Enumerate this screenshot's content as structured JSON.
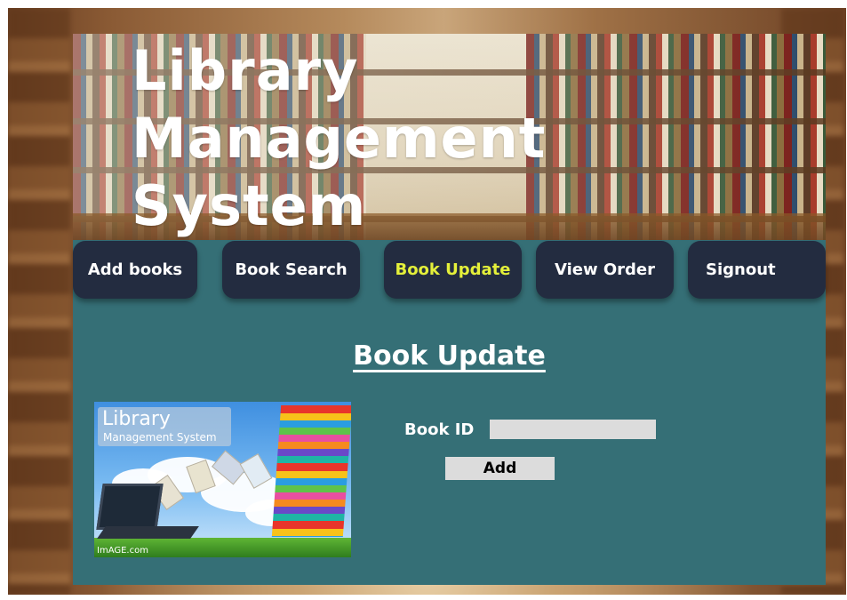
{
  "header": {
    "title_lines": [
      "Library",
      "Management",
      "System"
    ]
  },
  "nav": {
    "items": [
      {
        "label": "Add books",
        "active": false
      },
      {
        "label": "Book Search",
        "active": false
      },
      {
        "label": "Book Update",
        "active": true
      },
      {
        "label": "View Order",
        "active": false
      },
      {
        "label": "Signout",
        "active": false
      }
    ]
  },
  "main": {
    "section_title": "Book Update",
    "illustration": {
      "banner_title": "Library",
      "banner_subtitle": "Management System",
      "credit": "ImAGE.com"
    },
    "form": {
      "book_id_label": "Book ID",
      "book_id_value": "",
      "add_label": "Add"
    }
  },
  "colors": {
    "panel": "#356f76",
    "nav_button": "#232c40",
    "active_text": "#e4f03a",
    "input_bg": "#dcdcdc"
  }
}
